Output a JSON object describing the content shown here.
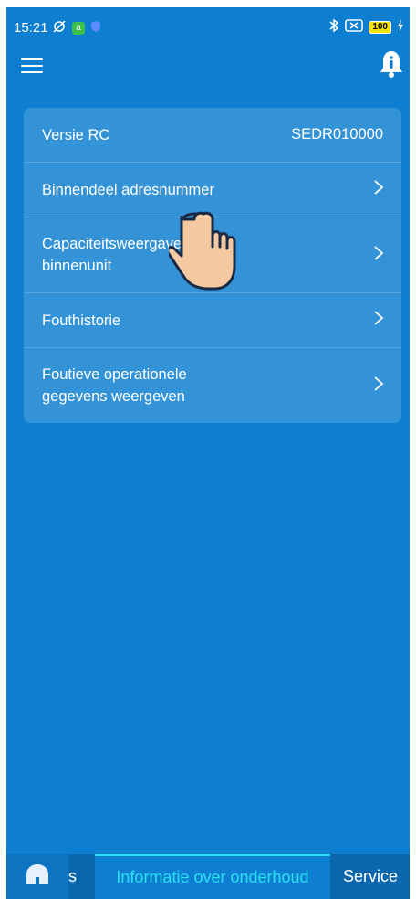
{
  "status_bar": {
    "time": "15:21",
    "battery": "100"
  },
  "info_card": {
    "version_row": {
      "label": "Versie RC",
      "value": "SEDR010000"
    },
    "items": [
      {
        "label_lines": [
          "Binnendeel adresnummer"
        ]
      },
      {
        "label_lines": [
          "Capaciteitsweergave",
          "binnenunit"
        ]
      },
      {
        "label_lines": [
          "Fouthistorie"
        ]
      },
      {
        "label_lines": [
          "Foutieve operationele",
          "gegevens weergeven"
        ]
      }
    ]
  },
  "bottom_nav": {
    "tab_partial": "s",
    "tab_active": "Informatie over onderhoud",
    "tab_service": "Service"
  },
  "colors": {
    "background": "#0e7fd0",
    "active_tab_text": "#2be0f0",
    "bottom_bar": "#0a67ad"
  }
}
